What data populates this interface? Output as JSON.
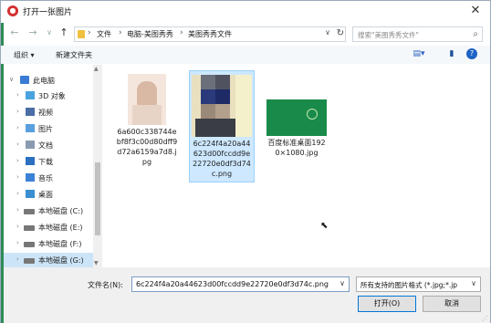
{
  "window": {
    "title": "打开一张图片",
    "close_glyph": "✕"
  },
  "nav": {
    "back": "←",
    "forward": "→",
    "dropdown": "∨",
    "up": "↑",
    "path": [
      "文件",
      "电脑-美图秀秀",
      "美图秀秀文件"
    ],
    "refresh": "↻",
    "search_placeholder": "搜索\"美图秀秀文件\"",
    "search_icon_glyph": "⌕"
  },
  "toolbar": {
    "organize": "组织 ▾",
    "new_folder": "新建文件夹",
    "help": "?"
  },
  "sidebar": {
    "items": [
      {
        "label": "此电脑",
        "icon": "computer-icon",
        "color": "#3a7bd5",
        "expanded": true
      },
      {
        "label": "3D 对象",
        "icon": "3d-objects-icon",
        "color": "#4aa3df"
      },
      {
        "label": "视频",
        "icon": "video-icon",
        "color": "#4a6fa5"
      },
      {
        "label": "图片",
        "icon": "pictures-icon",
        "color": "#5aa0e0"
      },
      {
        "label": "文档",
        "icon": "documents-icon",
        "color": "#8a9ab0"
      },
      {
        "label": "下载",
        "icon": "downloads-icon",
        "color": "#2a6fc0"
      },
      {
        "label": "音乐",
        "icon": "music-icon",
        "color": "#3b82d6"
      },
      {
        "label": "桌面",
        "icon": "desktop-icon",
        "color": "#3a8fd0"
      },
      {
        "label": "本地磁盘 (C:)",
        "icon": "drive-icon",
        "color": "#666"
      },
      {
        "label": "本地磁盘 (E:)",
        "icon": "drive-icon",
        "color": "#666"
      },
      {
        "label": "本地磁盘 (F:)",
        "icon": "drive-icon",
        "color": "#666"
      },
      {
        "label": "本地磁盘 (G:)",
        "icon": "drive-icon",
        "color": "#666",
        "selected": true
      }
    ]
  },
  "files": [
    {
      "name": "6a600c338744ebf8f3c00d80dff9d72a6159a7d8.jpg",
      "thumb": "portrait-photo"
    },
    {
      "name": "6c224f4a20a44623d00fccdd9e22720e0df3d74c.png",
      "thumb": "portrait-photo-pixelated",
      "selected": true
    },
    {
      "name": "百度标准桌面1920×1080.jpg",
      "thumb": "green-wallpaper"
    }
  ],
  "footer": {
    "filename_label": "文件名(N):",
    "filename_value": "6c224f4a20a44623d00fccdd9e22720e0df3d74c.png",
    "filetype_value": "所有支持的图片格式 (*.jpg;*.jp",
    "open": "打开(O)",
    "cancel": "取消"
  },
  "colors": {
    "accent": "#0078d7",
    "selection": "#cce4f7"
  }
}
